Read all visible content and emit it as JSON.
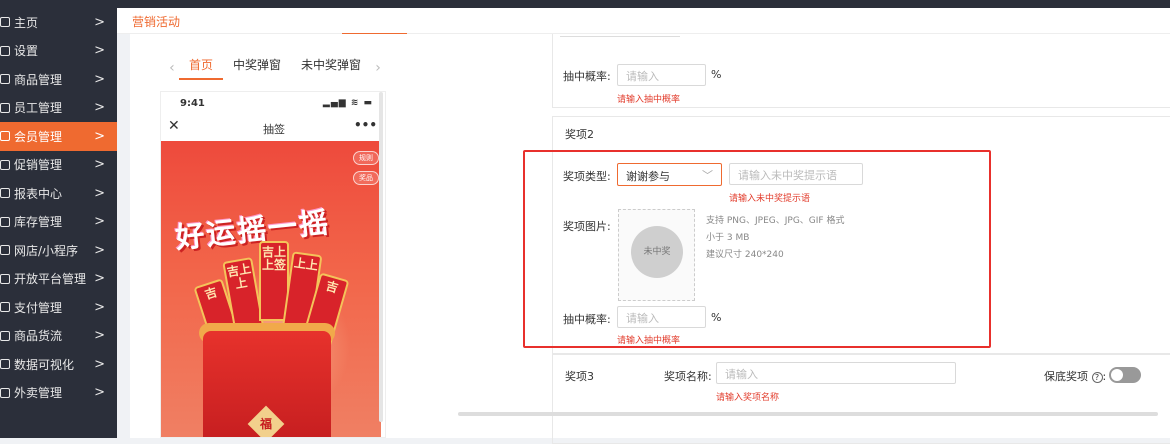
{
  "sidebar": {
    "items": [
      {
        "label": "主页",
        "icon": "home-icon"
      },
      {
        "label": "设置",
        "icon": "gear-icon"
      },
      {
        "label": "商品管理",
        "icon": "box-icon"
      },
      {
        "label": "员工管理",
        "icon": "user-icon"
      },
      {
        "label": "会员管理",
        "icon": "member-card-icon",
        "active": true
      },
      {
        "label": "促销管理",
        "icon": "promo-icon"
      },
      {
        "label": "报表中心",
        "icon": "chart-icon"
      },
      {
        "label": "库存管理",
        "icon": "stock-icon"
      },
      {
        "label": "网店/小程序",
        "icon": "shop-icon"
      },
      {
        "label": "开放平台管理",
        "icon": "platform-icon"
      },
      {
        "label": "支付管理",
        "icon": "pay-icon"
      },
      {
        "label": "商品货流",
        "icon": "flow-icon"
      },
      {
        "label": "数据可视化",
        "icon": "visual-icon"
      },
      {
        "label": "外卖管理",
        "icon": "takeout-icon"
      }
    ],
    "chevron": ">",
    "accent": "#ef6a30",
    "background": "#2b2f3a"
  },
  "breadcrumb": "营销活动",
  "preview": {
    "tabs": [
      "首页",
      "中奖弹窗",
      "未中奖弹窗"
    ],
    "prev_arrow": "‹",
    "next_arrow": "›",
    "status_time": "9:41",
    "status_icons": "▂▄▆ ≋ ▬",
    "nav_close": "✕",
    "nav_title": "抽签",
    "nav_more": "•••",
    "pill_rules": "规则",
    "pill_prizes": "奖品",
    "slogan": "好运摇一摇",
    "stick_texts": [
      "吉",
      "吉上上",
      "吉上上签",
      "上上",
      "吉",
      "吉上"
    ],
    "bucket_char": "福"
  },
  "form": {
    "prize1": {
      "probability_label": "抽中概率:",
      "probability_placeholder": "请输入",
      "unit": "%",
      "error": "请输入抽中概率"
    },
    "prize2": {
      "title": "奖项2",
      "type_label": "奖项类型:",
      "type_value": "谢谢参与",
      "type_caret": "﹀",
      "tip_placeholder": "请输入未中奖提示语",
      "tip_error": "请输入未中奖提示语",
      "image_label": "奖项图片:",
      "image_placeholder_text": "未中奖",
      "image_hints": [
        "支持 PNG、JPEG、JPG、GIF 格式",
        "小于 3 MB",
        "建议尺寸 240*240"
      ],
      "probability_label": "抽中概率:",
      "probability_placeholder": "请输入",
      "unit": "%",
      "error": "请输入抽中概率"
    },
    "prize3": {
      "title": "奖项3",
      "name_label": "奖项名称:",
      "name_placeholder": "请输入",
      "name_error": "请输入奖项名称",
      "fallback_label": "保底奖项",
      "fallback_help": "?",
      "fallback_on": false
    }
  },
  "colors": {
    "highlight": "#e8302c",
    "error": "#e23c2c"
  }
}
